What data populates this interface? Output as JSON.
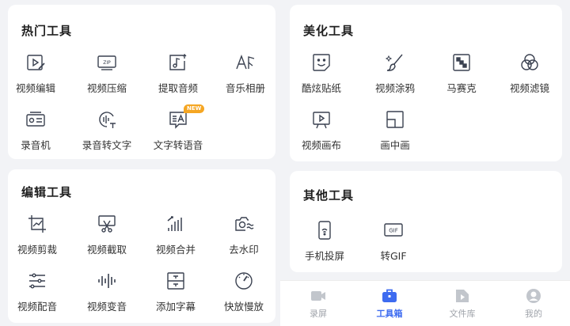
{
  "hot_tools": {
    "title": "热门工具",
    "items": [
      {
        "label": "视频编辑",
        "icon": "video-edit-icon"
      },
      {
        "label": "视频压缩",
        "icon": "zip-icon"
      },
      {
        "label": "提取音频",
        "icon": "music-extract-icon"
      },
      {
        "label": "音乐相册",
        "icon": "music-album-icon"
      },
      {
        "label": "录音机",
        "icon": "radio-icon"
      },
      {
        "label": "录音转文字",
        "icon": "speech-to-text-icon"
      },
      {
        "label": "文字转语音",
        "icon": "text-to-speech-icon",
        "badge": "NEW"
      }
    ]
  },
  "beauty_tools": {
    "title": "美化工具",
    "items": [
      {
        "label": "酷炫贴纸",
        "icon": "sticker-icon"
      },
      {
        "label": "视频涂鸦",
        "icon": "brush-icon"
      },
      {
        "label": "马赛克",
        "icon": "mosaic-icon"
      },
      {
        "label": "视频滤镜",
        "icon": "filter-icon"
      },
      {
        "label": "视频画布",
        "icon": "canvas-icon"
      },
      {
        "label": "画中画",
        "icon": "picture-in-picture-icon"
      }
    ]
  },
  "edit_tools": {
    "title": "编辑工具",
    "items": [
      {
        "label": "视频剪裁",
        "icon": "crop-icon"
      },
      {
        "label": "视频截取",
        "icon": "trim-icon"
      },
      {
        "label": "视频合并",
        "icon": "merge-icon"
      },
      {
        "label": "去水印",
        "icon": "remove-watermark-icon"
      },
      {
        "label": "视频配音",
        "icon": "dubbing-icon"
      },
      {
        "label": "视频变音",
        "icon": "voice-change-icon"
      },
      {
        "label": "添加字幕",
        "icon": "subtitle-icon"
      },
      {
        "label": "快放慢放",
        "icon": "speed-icon"
      }
    ]
  },
  "other_tools": {
    "title": "其他工具",
    "items": [
      {
        "label": "手机投屏",
        "icon": "screen-cast-icon"
      },
      {
        "label": "转GIF",
        "icon": "gif-icon",
        "glyph": "GIF"
      }
    ]
  },
  "tabbar": {
    "items": [
      {
        "label": "录屏",
        "icon": "record-screen-icon",
        "active": false
      },
      {
        "label": "工具箱",
        "icon": "toolbox-icon",
        "active": true
      },
      {
        "label": "文件库",
        "icon": "file-library-icon",
        "active": false
      },
      {
        "label": "我的",
        "icon": "profile-icon",
        "active": false
      }
    ]
  },
  "colors": {
    "icon": "#3a4150",
    "accent": "#3d6bf0",
    "badge": "#f5a623",
    "inactive_tab": "#a0a4ab"
  }
}
